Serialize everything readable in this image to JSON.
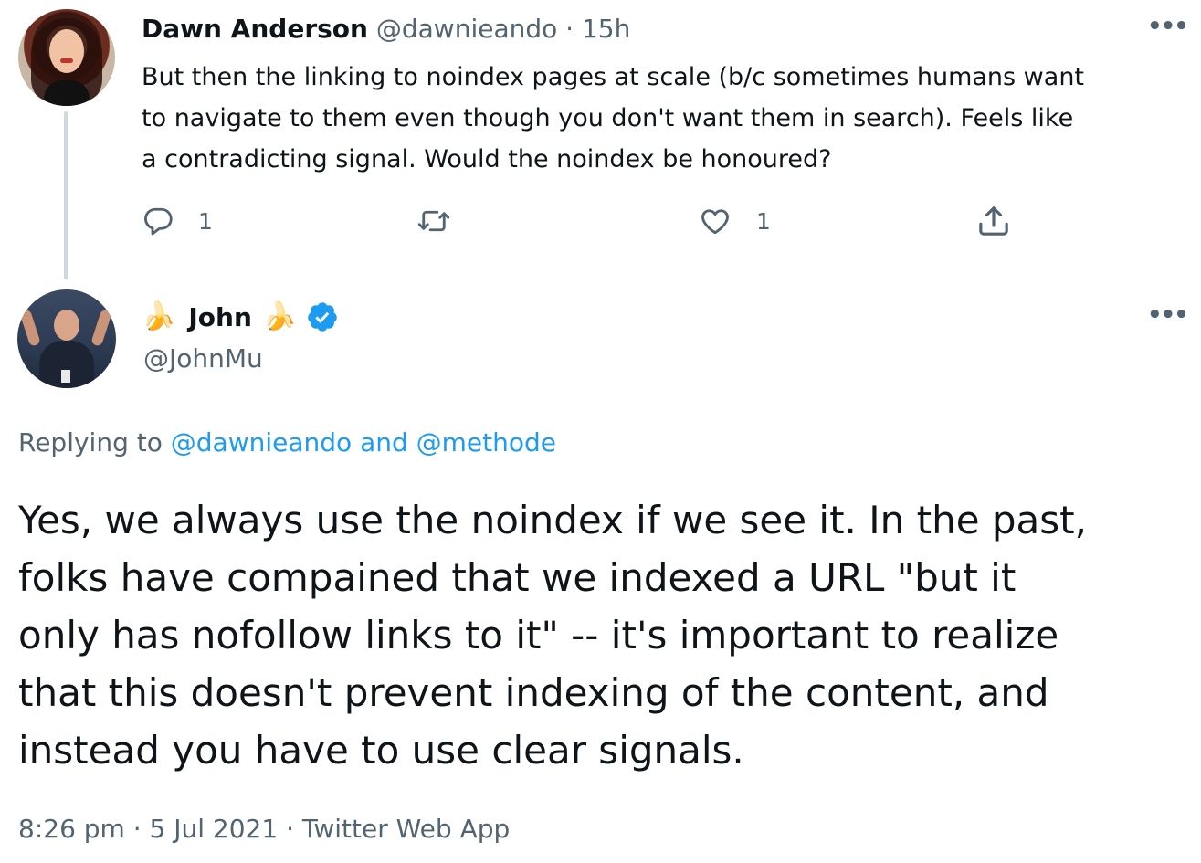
{
  "tweet1": {
    "display_name": "Dawn Anderson",
    "handle": "@dawnieando",
    "separator": " · ",
    "time": "15h",
    "more_label": "•••",
    "text_lines": [
      "But then the linking to noindex pages at scale (b/c sometimes humans want",
      "to navigate to them even though you don't want them in search).  Feels like",
      "a contradicting signal. Would the noindex be honoured?"
    ],
    "actions": {
      "reply": {
        "icon": "reply-icon",
        "count": "1"
      },
      "retweet": {
        "icon": "retweet-icon",
        "count": ""
      },
      "like": {
        "icon": "heart-icon",
        "count": "1"
      },
      "share": {
        "icon": "share-icon"
      }
    }
  },
  "tweet2": {
    "display_name": "John",
    "emoji": "🍌",
    "verified_icon": "verified-badge-icon",
    "handle": "@JohnMu",
    "more_label": "•••",
    "replying_prefix": "Replying to ",
    "replying_mention_1": "@dawnieando",
    "replying_and": " and ",
    "replying_mention_2": "@methode",
    "text_lines": [
      "Yes, we always use the noindex if we see it. In the past,",
      "folks have compained that we indexed a URL \"but it",
      "only has nofollow links to it\" -- it's important to realize",
      "that this doesn't prevent indexing of the content, and",
      "instead you have to use clear signals."
    ],
    "time": "8:26 pm",
    "date": "5 Jul 2021",
    "source": "Twitter Web App",
    "meta_separator": " · "
  },
  "colors": {
    "text": "#0f1419",
    "secondary": "#536471",
    "link": "#1d9bf0",
    "thread_line": "#cfd9de",
    "verified": "#1d9bf0"
  }
}
